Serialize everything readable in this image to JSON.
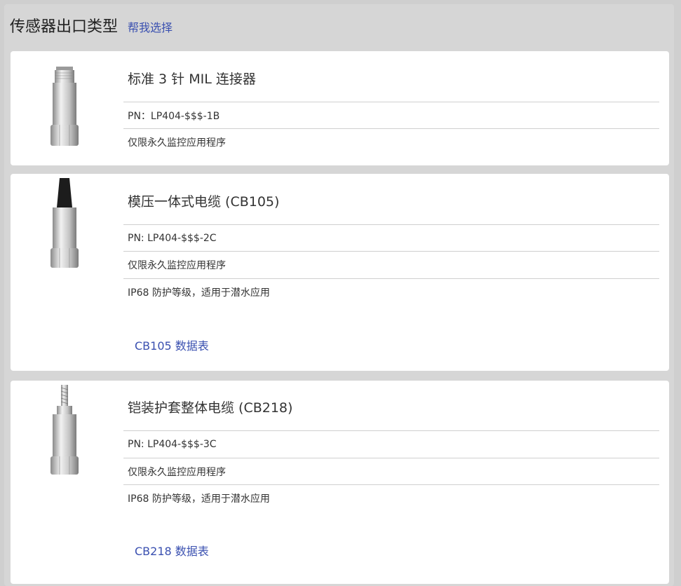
{
  "header": {
    "title": "传感器出口类型",
    "help_link": "帮我选择"
  },
  "cards": [
    {
      "name": "标准 3 针 MIL 连接器",
      "pn": "PN：LP404-$$$-1B",
      "details": [
        "仅限永久监控应用程序"
      ],
      "datasheet": ""
    },
    {
      "name": "模压一体式电缆 (CB105)",
      "pn": "PN: LP404-$$$-2C",
      "details": [
        "仅限永久监控应用程序",
        "IP68 防护等级，适用于潜水应用"
      ],
      "datasheet": "CB105 数据表"
    },
    {
      "name": "铠装护套整体电缆 (CB218)",
      "pn": "PN: LP404-$$$-3C",
      "details": [
        "仅限永久监控应用程序",
        "IP68 防护等级，适用于潜水应用"
      ],
      "datasheet": "CB218 数据表"
    }
  ]
}
